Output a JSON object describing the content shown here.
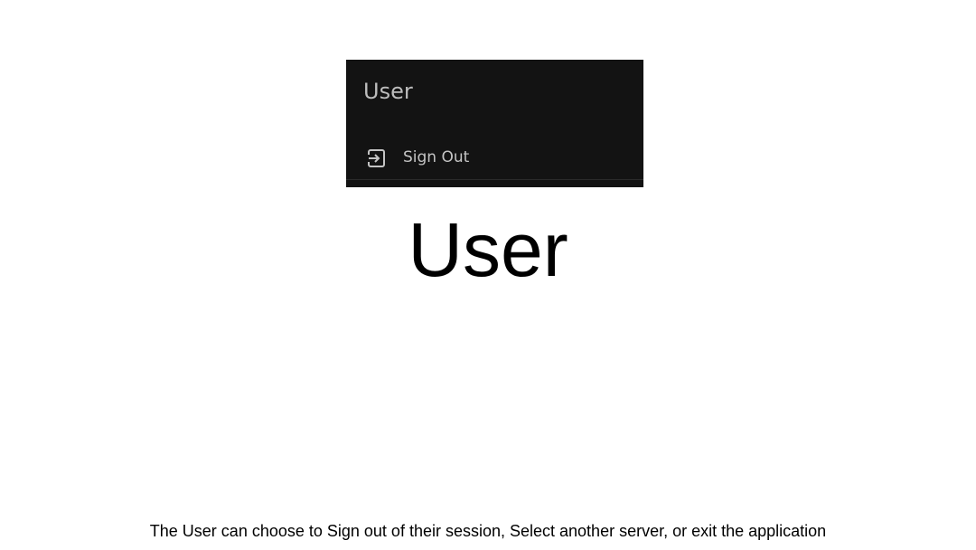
{
  "menu": {
    "header": "User",
    "items": [
      {
        "label": "Sign Out",
        "icon": "sign-out-icon"
      }
    ],
    "colors": {
      "background": "#131313",
      "text": "#c4c4c4"
    }
  },
  "slide": {
    "title": "User",
    "caption": "The User can choose to Sign out of their session, Select another server, or exit the application"
  }
}
